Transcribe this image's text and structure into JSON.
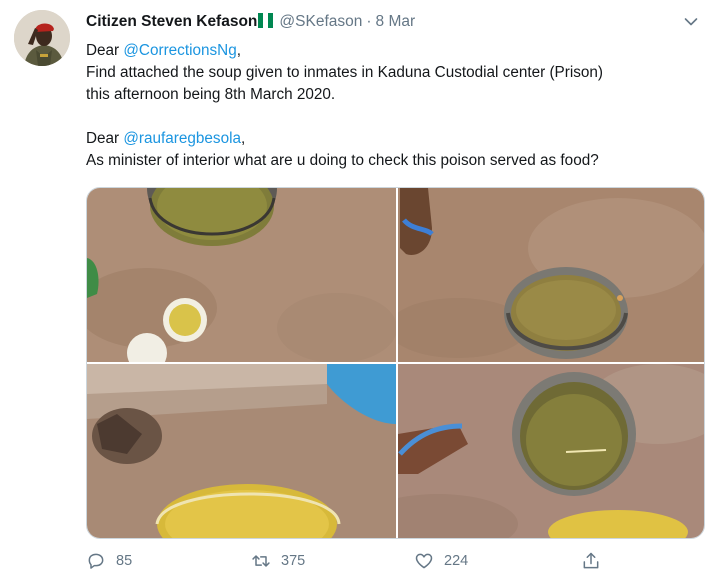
{
  "tweet": {
    "display_name": "Citizen Steven Kefason",
    "handle": "@SKefason",
    "separator": "·",
    "date": "8 Mar",
    "lines": {
      "l1_prefix": "Dear ",
      "l1_mention": "@CorrectionsNg",
      "l1_suffix": ",",
      "l2": "Find attached the soup given to inmates in Kaduna Custodial center (Prison)",
      "l3": "this afternoon being 8th March 2020.",
      "l4_prefix": "Dear ",
      "l4_mention": "@raufaregbesola",
      "l4_suffix": ",",
      "l5": "As minister of interior what are u doing to check this poison served as food?"
    },
    "actions": {
      "reply_count": "85",
      "retweet_count": "375",
      "like_count": "224"
    }
  },
  "icons": {
    "avatar": "avatar-photo",
    "flag": "nigeria-flag-icon",
    "caret": "chevron-down-icon",
    "reply": "reply-icon",
    "retweet": "retweet-icon",
    "like": "heart-icon",
    "share": "share-icon"
  },
  "colors": {
    "text": "#14171a",
    "secondary": "#657786",
    "link": "#1b95e0",
    "border": "#ccd6dd",
    "flag_green": "#008751"
  }
}
